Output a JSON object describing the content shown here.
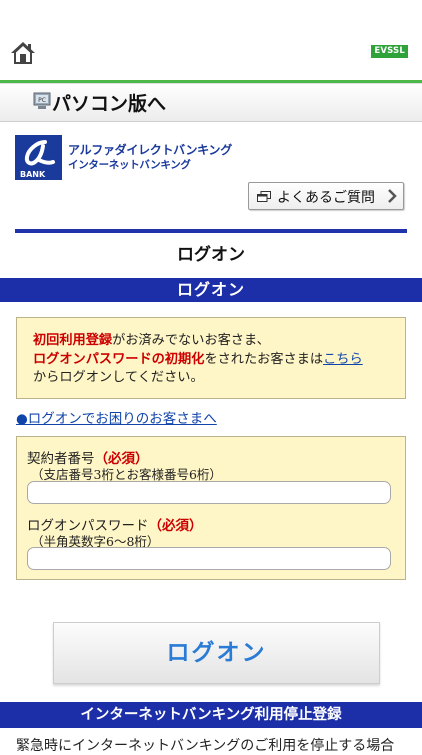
{
  "header": {
    "home_icon": "home-icon",
    "evssl_badge": "EVSSL",
    "accent_color": "#4cb849"
  },
  "pc_link": {
    "icon": "pc-icon",
    "label": "パソコン版へ"
  },
  "brand": {
    "logo_mark": "BANK",
    "line1": "アルファダイレクトバンキング",
    "line2": "インターネットバンキング",
    "color": "#1a3a9c"
  },
  "faq_button": {
    "icon": "window-icon",
    "label": "よくあるご質問",
    "chevron": "chevron-right-icon"
  },
  "page_title": "ログオン",
  "section_title": "ログオン",
  "notice": {
    "part1_red": "初回利用登録",
    "part2": "がお済みでないお客さま、",
    "part3_red": "ログオンパスワードの初期化",
    "part4": "をされたお客さまは",
    "link": "こちら",
    "part5": "からログオンしてください。"
  },
  "help_link": "●ログオンでお困りのお客さまへ",
  "form": {
    "contract_number": {
      "label": "契約者番号",
      "required": "（必須）",
      "hint": "（支店番号3桁とお客様番号6桁）",
      "value": ""
    },
    "password": {
      "label": "ログオンパスワード",
      "required": "（必須）",
      "hint": "（半角英数字6～8桁）",
      "value": ""
    }
  },
  "login_button": "ログオン",
  "stop_section_title": "インターネットバンキング利用停止登録",
  "stop_text": "緊急時にインターネットバンキングのご利用を停止する場合",
  "colors": {
    "navy": "#1c2fa8",
    "notice_bg": "#fff6c7",
    "required_red": "#cc0000",
    "link_blue": "#1144aa",
    "button_text": "#2a7bd6"
  }
}
